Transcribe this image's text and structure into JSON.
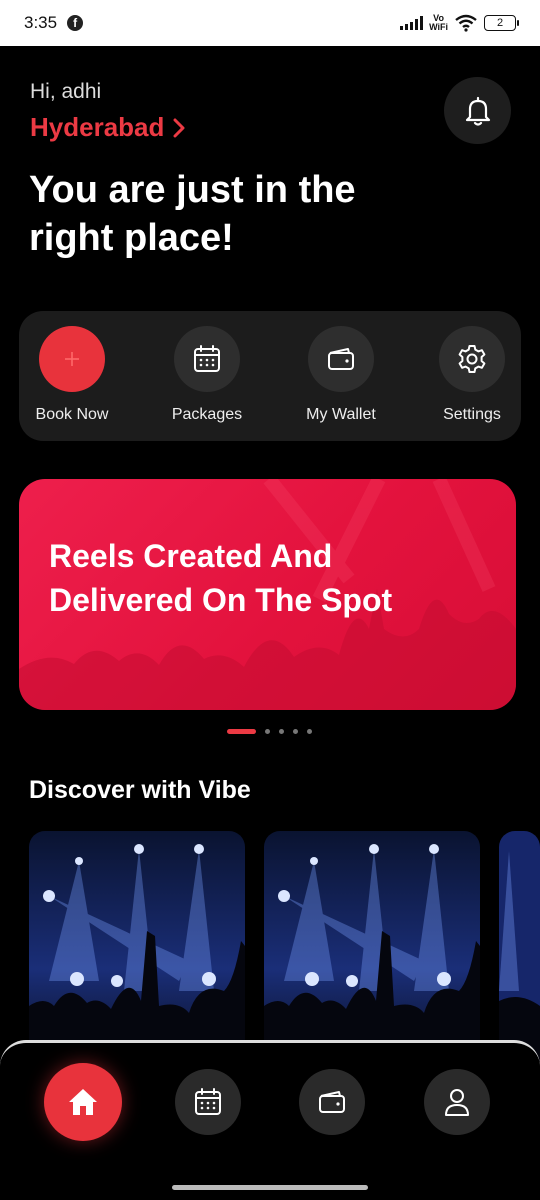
{
  "status_bar": {
    "time": "3:35",
    "network_top": "Vo",
    "network_bottom": "WiFi",
    "battery": "2"
  },
  "header": {
    "greeting": "Hi, adhi",
    "city": "Hyderabad",
    "headline": "You are just in the right place!"
  },
  "quick_actions": [
    {
      "label": "Book Now",
      "icon": "plus-icon"
    },
    {
      "label": "Packages",
      "icon": "calendar-icon"
    },
    {
      "label": "My Wallet",
      "icon": "wallet-icon"
    },
    {
      "label": "Settings",
      "icon": "gear-icon"
    }
  ],
  "banner": {
    "text": "Reels Created And Delivered On The Spot",
    "active_slide": 1,
    "slide_count": 5
  },
  "discover": {
    "title": "Discover with Vibe"
  },
  "bottom_nav": [
    {
      "icon": "home-icon",
      "active": true
    },
    {
      "icon": "calendar-icon",
      "active": false
    },
    {
      "icon": "wallet-icon",
      "active": false
    },
    {
      "icon": "user-icon",
      "active": false
    }
  ],
  "colors": {
    "accent": "#e8333c",
    "city": "#ec3a44",
    "banner": "#e3123d",
    "background": "#000000",
    "panel": "#1c1c1c"
  }
}
